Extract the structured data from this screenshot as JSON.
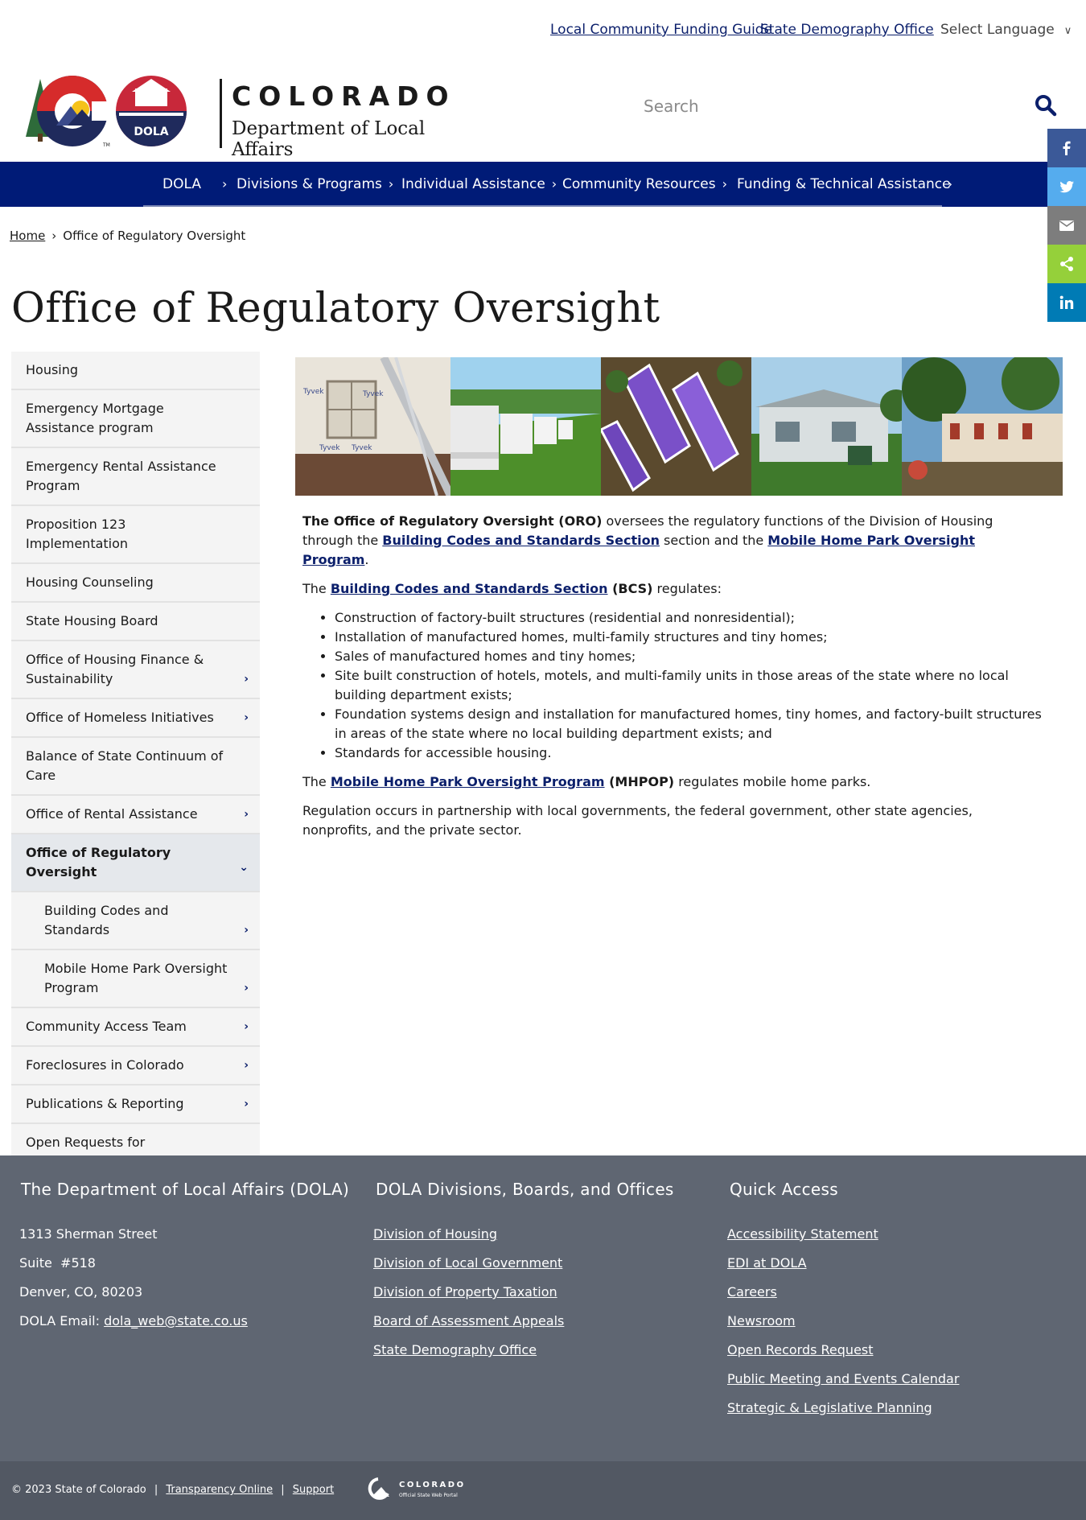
{
  "utility": {
    "links": [
      "Local Community Funding Guide",
      "State Demography Office"
    ],
    "language_label": "Select Language"
  },
  "header": {
    "brand_name": "COLORADO",
    "department": "Department of Local Affairs",
    "dola_badge": "DOLA",
    "search_placeholder": "Search"
  },
  "nav": {
    "items": [
      "DOLA",
      "Divisions & Programs",
      "Individual Assistance",
      "Community Resources",
      "Funding & Technical Assistance"
    ]
  },
  "share": {
    "icons": [
      "facebook-icon",
      "twitter-icon",
      "email-icon",
      "share-icon",
      "linkedin-icon"
    ],
    "colors": [
      "#3b5998",
      "#55acee",
      "#7d7d7d",
      "#95d03a",
      "#007bb5"
    ]
  },
  "breadcrumb": {
    "home": "Home",
    "separator": "›",
    "current": "Office of Regulatory Oversight"
  },
  "page": {
    "title": "Office of Regulatory Oversight"
  },
  "sidenav": {
    "items": [
      {
        "label": "Housing",
        "chevron": ""
      },
      {
        "label": "Emergency Mortgage Assistance program",
        "chevron": ""
      },
      {
        "label": "Emergency Rental Assistance Program",
        "chevron": ""
      },
      {
        "label": "Proposition 123 Implementation",
        "chevron": ""
      },
      {
        "label": "Housing Counseling",
        "chevron": ""
      },
      {
        "label": "State Housing Board",
        "chevron": ""
      },
      {
        "label": "Office of Housing Finance & Sustainability",
        "chevron": "›"
      },
      {
        "label": "Office of Homeless Initiatives",
        "chevron": "›"
      },
      {
        "label": "Balance of State Continuum of Care",
        "chevron": ""
      },
      {
        "label": "Office of Rental Assistance",
        "chevron": "›"
      },
      {
        "label": "Office of Regulatory Oversight",
        "chevron": "⌄"
      },
      {
        "label": "Building Codes and Standards",
        "chevron": "›"
      },
      {
        "label": "Mobile Home Park Oversight Program",
        "chevron": "›"
      },
      {
        "label": "Community Access Team",
        "chevron": "›"
      },
      {
        "label": "Foreclosures in Colorado",
        "chevron": "›"
      },
      {
        "label": "Publications & Reporting",
        "chevron": "›"
      },
      {
        "label": "Open Requests for Applications (RFAs) / Notice of Funding Availabilities (NOFA)",
        "chevron": ""
      }
    ]
  },
  "content": {
    "p1": {
      "strong": "The Office of Regulatory Oversight (ORO)",
      "text1": " oversees the regulatory functions of the Division of Housing through the ",
      "link1": "Building Codes and Standards Section",
      "text2": " section and the ",
      "link2": "Mobile Home Park Oversight Program",
      "text3": "."
    },
    "p2": {
      "text1": "The ",
      "link": "Building Codes and Standards Section",
      "strong": " (BCS)",
      "text2": " regulates:"
    },
    "bcs_list": [
      "Construction of factory-built structures (residential and nonresidential);",
      "Installation of manufactured homes, multi-family structures and tiny homes;",
      "Sales of manufactured homes and tiny homes;",
      "Site built construction of hotels, motels, and multi-family units in those areas of the state where no local building department exists;",
      "Foundation systems design and installation for manufactured homes, tiny homes, and factory-built structures in areas of the state where no local building department exists; and",
      "Standards for accessible housing."
    ],
    "p3": {
      "text1": "The ",
      "link": "Mobile Home Park Oversight Program",
      "strong": " (MHPOP)",
      "text2": " regulates mobile home parks."
    },
    "p4": "Regulation occurs in partnership with local governments, the federal government, other state agencies, nonprofits, and the private sector."
  },
  "footer": {
    "col1": {
      "heading": "The Department of Local Affairs (DOLA)",
      "address1": "1313 Sherman Street",
      "address2": "Suite  #518",
      "address3": "Denver, CO, 80203",
      "email_label": "DOLA Email: ",
      "email": "dola_web@state.co.us"
    },
    "col2": {
      "heading": "DOLA Divisions, Boards, and Offices",
      "links": [
        "Division of Housing",
        "Division of Local Government",
        "Division of Property Taxation",
        "Board of Assessment Appeals",
        "State Demography Office"
      ]
    },
    "col3": {
      "heading": "Quick Access",
      "links": [
        "Accessibility Statement",
        "EDI at DOLA",
        "Careers",
        "Newsroom",
        "Open Records Request",
        "Public Meeting and Events Calendar",
        "Strategic & Legislative Planning"
      ]
    },
    "copyright": "© 2023 State of Colorado",
    "divider": "|",
    "bottom_links": [
      "Transparency Online",
      "Support"
    ],
    "portal_name": "COLORADO",
    "portal_tagline": "Official State Web Portal"
  }
}
